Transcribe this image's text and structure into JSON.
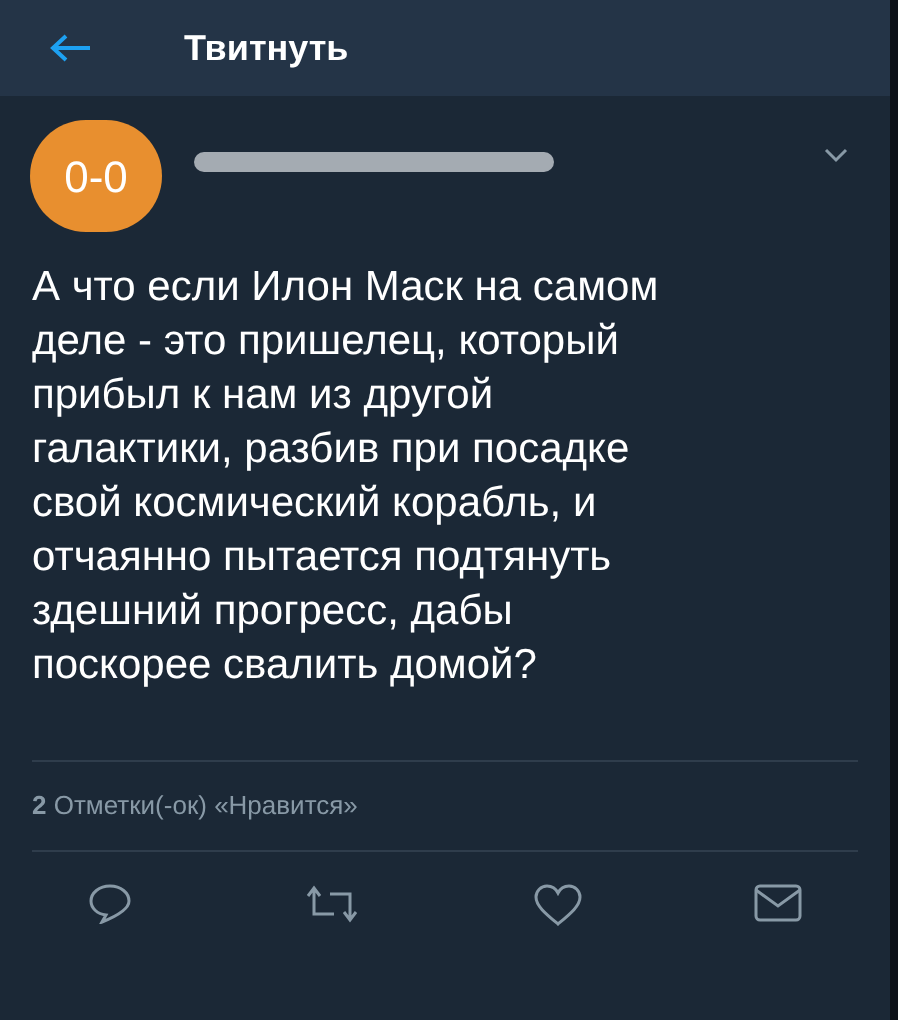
{
  "header": {
    "title": "Твитнуть"
  },
  "tweet": {
    "avatar_text": "0-0",
    "text": "А что если Илон Маск на самом\nделе - это пришелец, который\nприбыл к нам из другой\nгалактики, разбив при посадке\nсвой космический корабль, и\nотчаянно пытается подтянуть\nздешний прогресс, дабы\nпоскорее свалить домой?",
    "likes": "**2** Отметки(-ок) «Нравится»"
  }
}
